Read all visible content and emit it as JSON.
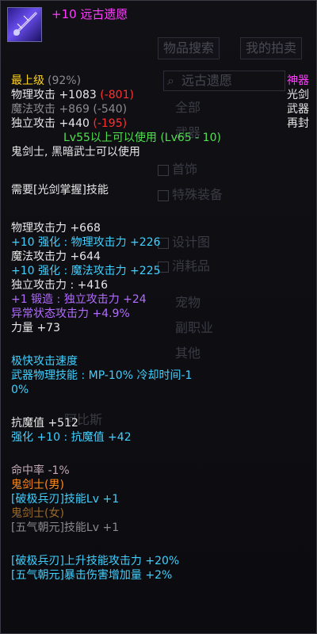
{
  "item": {
    "title": "+10 远古遗愿",
    "grade": "最上级",
    "grade_pct": "(92%)",
    "rarity": "神器",
    "type1": "光剑",
    "type2": "武器",
    "type3": "再封",
    "stats": {
      "phys_label": "物理攻击",
      "phys_val": "+1083",
      "phys_diff": "(-801)",
      "mag_label": "魔法攻击",
      "mag_val": "+869",
      "mag_diff": "(-540)",
      "ind_label": "独立攻击",
      "ind_val": "+440",
      "ind_diff": "(-195)"
    },
    "level_req": "Lv55以上可以使用 (Lv65 - 10)",
    "class_req": "鬼剑士, 黑暗武士可以使用",
    "skill_req": "需要[光剑掌握]技能",
    "attack": {
      "phys": "物理攻击力 +668",
      "phys_enh": "+10 强化 : 物理攻击力 +226",
      "mag": "魔法攻击力 +644",
      "mag_enh": "+10 强化 : 魔法攻击力 +225",
      "ind": "独立攻击力 : +416",
      "forge": "+1 锻造 : 独立攻击力 +24",
      "abnormal": "异常状态攻击力 +4.9%",
      "str": "力量 +73"
    },
    "speed": "极快攻击速度",
    "weapon_skill_1": "武器物理技能 :  MP-10% 冷却时间-1",
    "weapon_skill_2": "0%",
    "magic_resist": "抗魔值 +512",
    "magic_resist_enh": "强化 +10 : 抗魔值 +42",
    "hit": "命中率 -1%",
    "male_class": "鬼剑士(男)",
    "male_skill_1": "[破极兵刃]技能Lv +1",
    "female_class": "鬼剑士(女)",
    "female_skill_1": "[五气朝元]技能Lv +1",
    "bonus_1": "[破极兵刃]上升技能攻击力 +20%",
    "bonus_2": "[五气朝元]暴击伤害增加量 +2%"
  },
  "background": {
    "tab1": "物品搜索",
    "tab2": "我的拍卖",
    "search": "远古遗愿",
    "cat_all": "全部",
    "cat_weapon": "武器",
    "cat_jewel": "首饰",
    "cat_special": "特殊装备",
    "cat_design": "设计图",
    "cat_consumable": "消耗品",
    "cat_pet": "宠物",
    "cat_job": "副职业",
    "cat_other": "其他",
    "npc": "阿比斯"
  },
  "colors": {
    "title": "#ff3cff",
    "grade": "#ffd21a",
    "diff": "#ff3030",
    "enhance": "#3fd0ff",
    "forge": "#b26cff",
    "level": "#50e050",
    "male_class": "#ff8a1a"
  }
}
